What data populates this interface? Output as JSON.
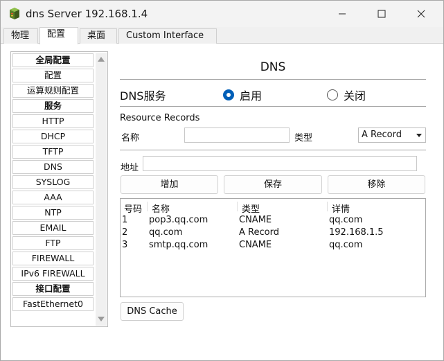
{
  "window": {
    "title": "dns Server 192.168.1.4",
    "minimize_icon": "minimize-icon",
    "maximize_icon": "maximize-icon",
    "close_icon": "close-icon"
  },
  "tabs": [
    {
      "label": "物理"
    },
    {
      "label": "配置"
    },
    {
      "label": "桌面"
    },
    {
      "label": "Custom Interface"
    }
  ],
  "active_tab": "配置",
  "sidebar": {
    "items": [
      {
        "label": "全局配置",
        "header": true
      },
      {
        "label": "配置",
        "header": false
      },
      {
        "label": "运算规则配置",
        "header": false
      },
      {
        "label": "服务",
        "header": true
      },
      {
        "label": "HTTP",
        "header": false
      },
      {
        "label": "DHCP",
        "header": false
      },
      {
        "label": "TFTP",
        "header": false
      },
      {
        "label": "DNS",
        "header": false
      },
      {
        "label": "SYSLOG",
        "header": false
      },
      {
        "label": "AAA",
        "header": false
      },
      {
        "label": "NTP",
        "header": false
      },
      {
        "label": "EMAIL",
        "header": false
      },
      {
        "label": "FTP",
        "header": false
      },
      {
        "label": "FIREWALL",
        "header": false
      },
      {
        "label": "IPv6 FIREWALL",
        "header": false
      },
      {
        "label": "接口配置",
        "header": true
      },
      {
        "label": "FastEthernet0",
        "header": false
      }
    ]
  },
  "dns": {
    "title": "DNS",
    "service_label": "DNS服务",
    "on_label": "启用",
    "off_label": "关闭",
    "service_enabled": true,
    "resource_records_label": "Resource Records",
    "name_label": "名称",
    "name_value": "",
    "type_label": "类型",
    "type_value": "A Record",
    "address_label": "地址",
    "address_value": "",
    "add_button": "增加",
    "save_button": "保存",
    "remove_button": "移除",
    "cache_button": "DNS Cache",
    "columns": [
      "号码",
      "名称",
      "类型",
      "详情"
    ],
    "rows": [
      [
        "1",
        "pop3.qq.com",
        "CNAME",
        "qq.com"
      ],
      [
        "2",
        "qq.com",
        "A Record",
        "192.168.1.5"
      ],
      [
        "3",
        "smtp.qq.com",
        "CNAME",
        "qq.com"
      ]
    ]
  },
  "colors": {
    "radio_accent": "#005fb8"
  }
}
